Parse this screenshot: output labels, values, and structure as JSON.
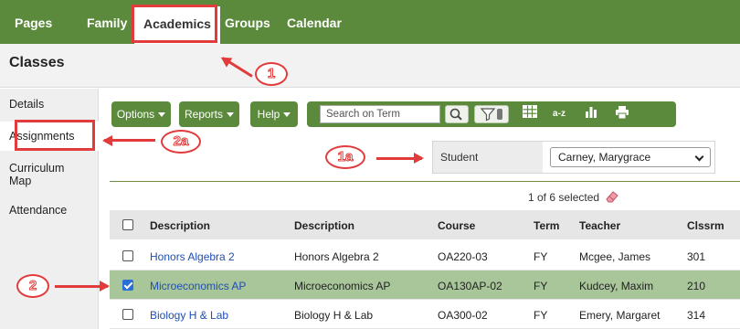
{
  "nav": {
    "items": [
      {
        "label": "Pages"
      },
      {
        "label": "Family"
      },
      {
        "label": "Academics"
      },
      {
        "label": "Groups"
      },
      {
        "label": "Calendar"
      }
    ],
    "active": "Academics"
  },
  "header": {
    "title": "Classes"
  },
  "sidebar": {
    "items": [
      {
        "label": "Details"
      },
      {
        "label": "Assignments"
      },
      {
        "label": "Curriculum Map"
      },
      {
        "label": "Attendance"
      }
    ],
    "selected": "Assignments"
  },
  "toolbar": {
    "options_label": "Options",
    "reports_label": "Reports",
    "help_label": "Help",
    "search_placeholder": "Search on Term",
    "az_label": "a-z"
  },
  "student": {
    "label": "Student",
    "selected": "Carney, Marygrace"
  },
  "selection": {
    "text": "1 of 6 selected"
  },
  "table": {
    "columns": [
      "Description",
      "Description",
      "Course",
      "Term",
      "Teacher",
      "Clssrm"
    ],
    "rows": [
      {
        "link": "Honors Algebra 2",
        "description": "Honors Algebra 2",
        "course": "OA220-03",
        "term": "FY",
        "teacher": "Mcgee, James",
        "room": "301",
        "checked": false
      },
      {
        "link": "Microeconomics AP",
        "description": "Microeconomics AP",
        "course": "OA130AP-02",
        "term": "FY",
        "teacher": "Kudcey, Maxim",
        "room": "210",
        "checked": true
      },
      {
        "link": "Biology H & Lab",
        "description": "Biology H & Lab",
        "course": "OA300-02",
        "term": "FY",
        "teacher": "Emery, Margaret",
        "room": "314",
        "checked": false
      }
    ]
  },
  "callouts": {
    "c1": "1",
    "c1a": "1a",
    "c2": "2",
    "c2a": "2a"
  },
  "colors": {
    "brand_green": "#5b8a3c",
    "highlight_row": "#a8c69a",
    "annotation_red": "#e23b3b",
    "link_blue": "#1f4fb3"
  }
}
